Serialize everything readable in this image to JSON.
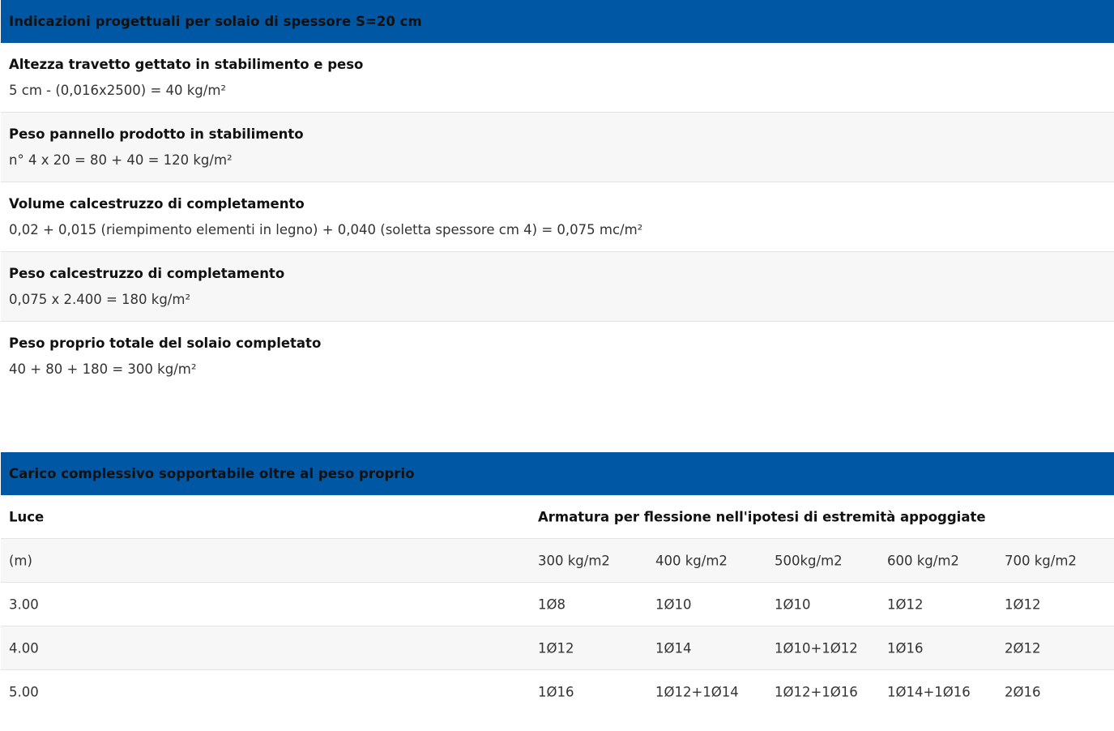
{
  "design_table": {
    "header": "Indicazioni progettuali per solaio di spessore S=20 cm",
    "rows": [
      {
        "title": "Altezza travetto gettato in stabilimento e peso",
        "value": "5 cm - (0,016x2500) = 40 kg/m²"
      },
      {
        "title": "Peso pannello prodotto in stabilimento",
        "value": "n° 4 x 20 = 80 + 40 = 120 kg/m²"
      },
      {
        "title": "Volume calcestruzzo di completamento",
        "value": "0,02 + 0,015 (riempimento elementi in legno) + 0,040 (soletta spessore cm 4) = 0,075 mc/m²"
      },
      {
        "title": "Peso calcestruzzo di completamento",
        "value": "0,075 x 2.400 = 180 kg/m²"
      },
      {
        "title": "Peso proprio totale del solaio completato",
        "value": "40 + 80 + 180 = 300 kg/m²"
      }
    ]
  },
  "load_table": {
    "header": "Carico complessivo sopportabile oltre al peso proprio",
    "col_header_luce": "Luce",
    "col_header_armatura": "Armatura per flessione nell'ipotesi di estremità appoggiate",
    "unit_row": [
      "(m)",
      "300 kg/m2",
      "400 kg/m2",
      "500kg/m2",
      "600 kg/m2",
      "700 kg/m2"
    ],
    "rows": [
      [
        "3.00",
        "1Ø8",
        "1Ø10",
        "1Ø10",
        "1Ø12",
        "1Ø12"
      ],
      [
        "4.00",
        "1Ø12",
        "1Ø14",
        "1Ø10+1Ø12",
        "1Ø16",
        "2Ø12"
      ],
      [
        "5.00",
        "1Ø16",
        "1Ø12+1Ø14",
        "1Ø12+1Ø16",
        "1Ø14+1Ø16",
        "2Ø16"
      ]
    ]
  },
  "colors": {
    "header_bg": "#0057a4",
    "alt_row_bg": "#f7f7f7",
    "divider": "#e3e3e3"
  }
}
